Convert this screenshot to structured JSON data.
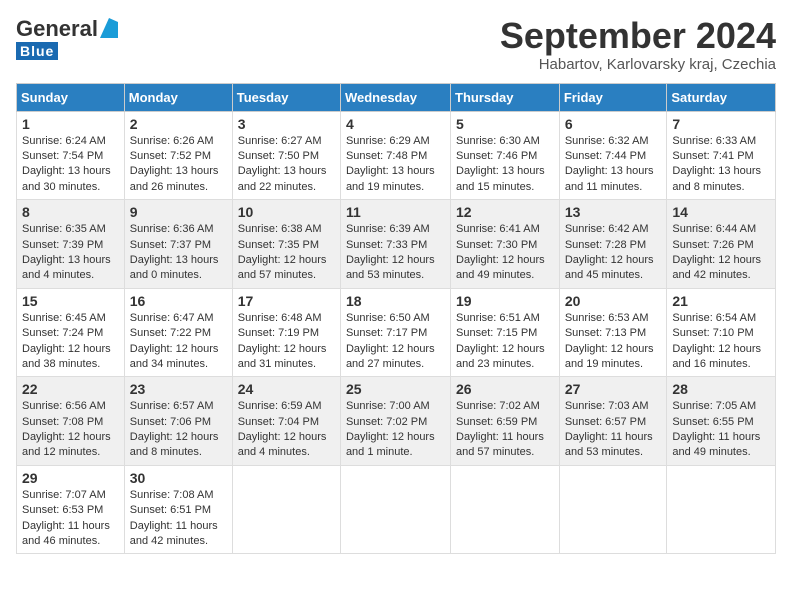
{
  "logo": {
    "general": "General",
    "blue": "Blue"
  },
  "title": "September 2024",
  "subtitle": "Habartov, Karlovarsky kraj, Czechia",
  "header": {
    "days": [
      "Sunday",
      "Monday",
      "Tuesday",
      "Wednesday",
      "Thursday",
      "Friday",
      "Saturday"
    ]
  },
  "weeks": [
    [
      {
        "day": "1",
        "info": "Sunrise: 6:24 AM\nSunset: 7:54 PM\nDaylight: 13 hours\nand 30 minutes."
      },
      {
        "day": "2",
        "info": "Sunrise: 6:26 AM\nSunset: 7:52 PM\nDaylight: 13 hours\nand 26 minutes."
      },
      {
        "day": "3",
        "info": "Sunrise: 6:27 AM\nSunset: 7:50 PM\nDaylight: 13 hours\nand 22 minutes."
      },
      {
        "day": "4",
        "info": "Sunrise: 6:29 AM\nSunset: 7:48 PM\nDaylight: 13 hours\nand 19 minutes."
      },
      {
        "day": "5",
        "info": "Sunrise: 6:30 AM\nSunset: 7:46 PM\nDaylight: 13 hours\nand 15 minutes."
      },
      {
        "day": "6",
        "info": "Sunrise: 6:32 AM\nSunset: 7:44 PM\nDaylight: 13 hours\nand 11 minutes."
      },
      {
        "day": "7",
        "info": "Sunrise: 6:33 AM\nSunset: 7:41 PM\nDaylight: 13 hours\nand 8 minutes."
      }
    ],
    [
      {
        "day": "8",
        "info": "Sunrise: 6:35 AM\nSunset: 7:39 PM\nDaylight: 13 hours\nand 4 minutes."
      },
      {
        "day": "9",
        "info": "Sunrise: 6:36 AM\nSunset: 7:37 PM\nDaylight: 13 hours\nand 0 minutes."
      },
      {
        "day": "10",
        "info": "Sunrise: 6:38 AM\nSunset: 7:35 PM\nDaylight: 12 hours\nand 57 minutes."
      },
      {
        "day": "11",
        "info": "Sunrise: 6:39 AM\nSunset: 7:33 PM\nDaylight: 12 hours\nand 53 minutes."
      },
      {
        "day": "12",
        "info": "Sunrise: 6:41 AM\nSunset: 7:30 PM\nDaylight: 12 hours\nand 49 minutes."
      },
      {
        "day": "13",
        "info": "Sunrise: 6:42 AM\nSunset: 7:28 PM\nDaylight: 12 hours\nand 45 minutes."
      },
      {
        "day": "14",
        "info": "Sunrise: 6:44 AM\nSunset: 7:26 PM\nDaylight: 12 hours\nand 42 minutes."
      }
    ],
    [
      {
        "day": "15",
        "info": "Sunrise: 6:45 AM\nSunset: 7:24 PM\nDaylight: 12 hours\nand 38 minutes."
      },
      {
        "day": "16",
        "info": "Sunrise: 6:47 AM\nSunset: 7:22 PM\nDaylight: 12 hours\nand 34 minutes."
      },
      {
        "day": "17",
        "info": "Sunrise: 6:48 AM\nSunset: 7:19 PM\nDaylight: 12 hours\nand 31 minutes."
      },
      {
        "day": "18",
        "info": "Sunrise: 6:50 AM\nSunset: 7:17 PM\nDaylight: 12 hours\nand 27 minutes."
      },
      {
        "day": "19",
        "info": "Sunrise: 6:51 AM\nSunset: 7:15 PM\nDaylight: 12 hours\nand 23 minutes."
      },
      {
        "day": "20",
        "info": "Sunrise: 6:53 AM\nSunset: 7:13 PM\nDaylight: 12 hours\nand 19 minutes."
      },
      {
        "day": "21",
        "info": "Sunrise: 6:54 AM\nSunset: 7:10 PM\nDaylight: 12 hours\nand 16 minutes."
      }
    ],
    [
      {
        "day": "22",
        "info": "Sunrise: 6:56 AM\nSunset: 7:08 PM\nDaylight: 12 hours\nand 12 minutes."
      },
      {
        "day": "23",
        "info": "Sunrise: 6:57 AM\nSunset: 7:06 PM\nDaylight: 12 hours\nand 8 minutes."
      },
      {
        "day": "24",
        "info": "Sunrise: 6:59 AM\nSunset: 7:04 PM\nDaylight: 12 hours\nand 4 minutes."
      },
      {
        "day": "25",
        "info": "Sunrise: 7:00 AM\nSunset: 7:02 PM\nDaylight: 12 hours\nand 1 minute."
      },
      {
        "day": "26",
        "info": "Sunrise: 7:02 AM\nSunset: 6:59 PM\nDaylight: 11 hours\nand 57 minutes."
      },
      {
        "day": "27",
        "info": "Sunrise: 7:03 AM\nSunset: 6:57 PM\nDaylight: 11 hours\nand 53 minutes."
      },
      {
        "day": "28",
        "info": "Sunrise: 7:05 AM\nSunset: 6:55 PM\nDaylight: 11 hours\nand 49 minutes."
      }
    ],
    [
      {
        "day": "29",
        "info": "Sunrise: 7:07 AM\nSunset: 6:53 PM\nDaylight: 11 hours\nand 46 minutes."
      },
      {
        "day": "30",
        "info": "Sunrise: 7:08 AM\nSunset: 6:51 PM\nDaylight: 11 hours\nand 42 minutes."
      },
      {
        "day": "",
        "info": ""
      },
      {
        "day": "",
        "info": ""
      },
      {
        "day": "",
        "info": ""
      },
      {
        "day": "",
        "info": ""
      },
      {
        "day": "",
        "info": ""
      }
    ]
  ]
}
